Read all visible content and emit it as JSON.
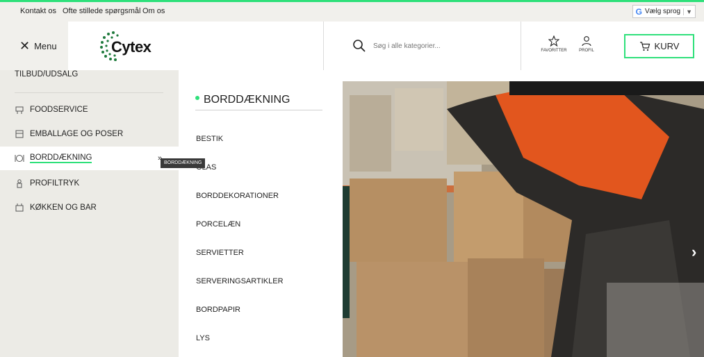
{
  "topbar": {
    "links": [
      "Kontakt os",
      "Ofte stillede spørgsmål",
      "Om os"
    ],
    "language_label": "Vælg sprog"
  },
  "header": {
    "menu_label": "Menu",
    "logo_text": "Cytex",
    "search_placeholder": "Søg i alle kategorier...",
    "favorites_label": "FAVORITTER",
    "profile_label": "PROFIL",
    "cart_label": "KURV"
  },
  "sidebar": {
    "top_item": "TILBUD/UDSALG",
    "items": [
      {
        "label": "FOODSERVICE",
        "icon": "foodservice-icon"
      },
      {
        "label": "EMBALLAGE OG POSER",
        "icon": "package-icon"
      },
      {
        "label": "BORDDÆKNING",
        "icon": "table-setting-icon",
        "active": true
      },
      {
        "label": "PROFILTRYK",
        "icon": "print-icon"
      },
      {
        "label": "KØKKEN OG BAR",
        "icon": "kitchen-icon"
      }
    ],
    "tooltip": "BORDDÆKNING"
  },
  "submenu": {
    "title": "BORDDÆKNING",
    "items": [
      "BESTIK",
      "GLAS",
      "BORDDEKORATIONER",
      "PORCELÆN",
      "SERVIETTER",
      "SERVERINGSARTIKLER",
      "BORDPAPIR",
      "LYS"
    ]
  },
  "colors": {
    "accent": "#2ee07a",
    "sidebar_bg": "#ecebe6",
    "topbar_bg": "#f1f0ec"
  }
}
